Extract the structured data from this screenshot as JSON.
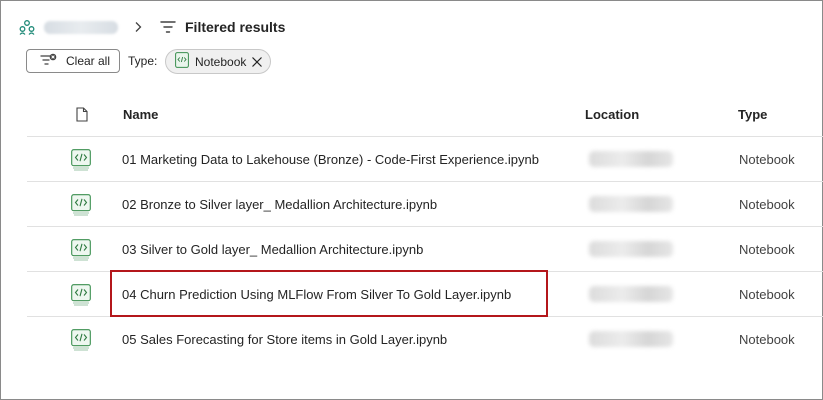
{
  "breadcrumb": {
    "workspace_icon": "workspace-icon",
    "separator_icon": "chevron-right-icon",
    "filter_icon": "filter-icon",
    "title": "Filtered results"
  },
  "filters": {
    "clear_all_label": "Clear all",
    "type_label": "Type:",
    "chip_label": "Notebook"
  },
  "table": {
    "columns": [
      "Name",
      "Location",
      "Type"
    ],
    "rows": [
      {
        "name": "01 Marketing Data to Lakehouse (Bronze) - Code-First Experience.ipynb",
        "type": "Notebook"
      },
      {
        "name": "02 Bronze to Silver layer_ Medallion Architecture.ipynb",
        "type": "Notebook"
      },
      {
        "name": "03 Silver to Gold layer_ Medallion Architecture.ipynb",
        "type": "Notebook"
      },
      {
        "name": "04 Churn Prediction Using MLFlow From Silver To Gold Layer.ipynb",
        "type": "Notebook"
      },
      {
        "name": "05 Sales Forecasting for Store items in Gold Layer.ipynb",
        "type": "Notebook"
      }
    ]
  },
  "highlight_color": "#b4171b"
}
